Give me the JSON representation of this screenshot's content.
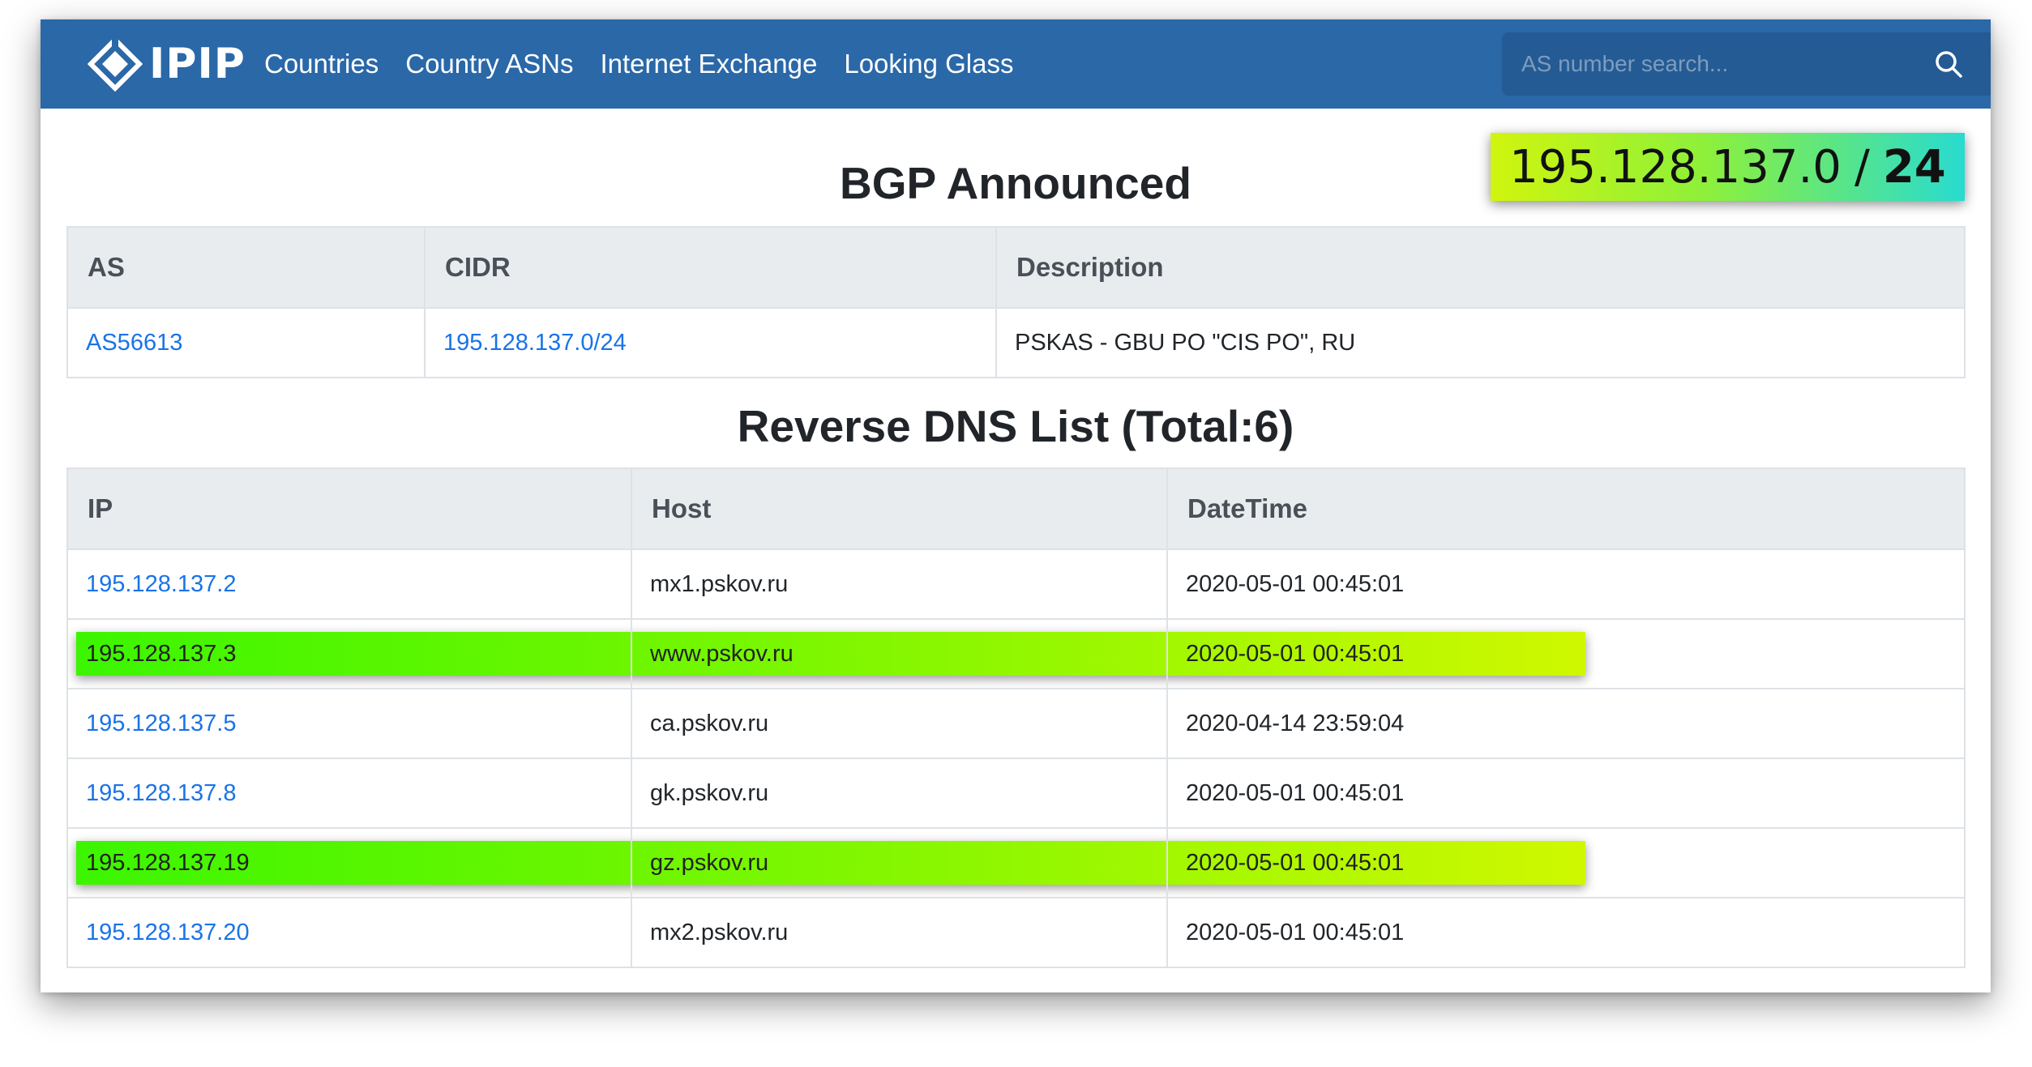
{
  "navbar": {
    "brand": "IPIP",
    "links": [
      "Countries",
      "Country ASNs",
      "Internet Exchange",
      "Looking Glass"
    ],
    "search_placeholder": "AS number search..."
  },
  "cidr_badge": {
    "address": "195.128.137.0",
    "separator": "/",
    "prefix_length": "24"
  },
  "bgp": {
    "title": "BGP Announced",
    "headers": [
      "AS",
      "CIDR",
      "Description"
    ],
    "rows": [
      {
        "as": "AS56613",
        "cidr": "195.128.137.0/24",
        "description": "PSKAS - GBU PO \"CIS PO\", RU"
      }
    ]
  },
  "rdns": {
    "title": "Reverse DNS List (Total:6)",
    "headers": [
      "IP",
      "Host",
      "DateTime"
    ],
    "rows": [
      {
        "ip": "195.128.137.2",
        "host": "mx1.pskov.ru",
        "datetime": "2020-05-01 00:45:01",
        "highlighted": false
      },
      {
        "ip": "195.128.137.3",
        "host": "www.pskov.ru",
        "datetime": "2020-05-01 00:45:01",
        "highlighted": true
      },
      {
        "ip": "195.128.137.5",
        "host": "ca.pskov.ru",
        "datetime": "2020-04-14 23:59:04",
        "highlighted": false
      },
      {
        "ip": "195.128.137.8",
        "host": "gk.pskov.ru",
        "datetime": "2020-05-01 00:45:01",
        "highlighted": false
      },
      {
        "ip": "195.128.137.19",
        "host": "gz.pskov.ru",
        "datetime": "2020-05-01 00:45:01",
        "highlighted": true
      },
      {
        "ip": "195.128.137.20",
        "host": "mx2.pskov.ru",
        "datetime": "2020-05-01 00:45:01",
        "highlighted": false
      }
    ]
  },
  "colors": {
    "navbar_bg": "#2a68a8",
    "link": "#1a73e8",
    "highlight_gradient": [
      "#3cf500",
      "#cff800"
    ],
    "badge_gradient": [
      "#d0f50e",
      "#28dbd0"
    ]
  }
}
